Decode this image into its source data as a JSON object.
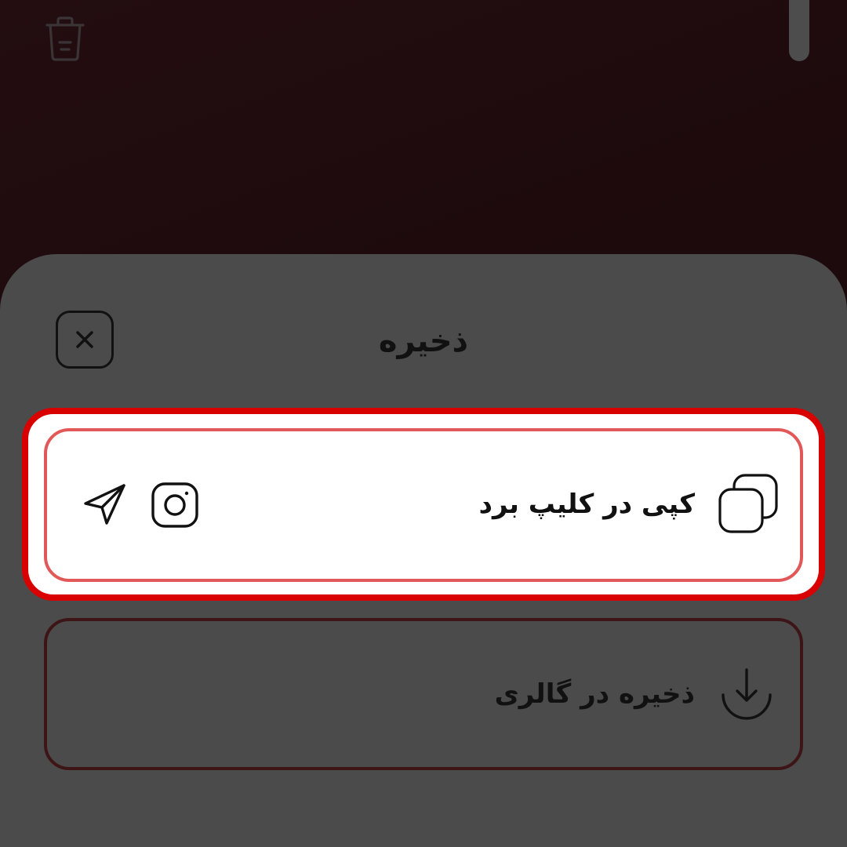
{
  "sheet": {
    "title": "ذخیره",
    "rows": [
      {
        "label": "کپی در کلیپ برد",
        "icon": "copy-icon",
        "share_icons": [
          "instagram-icon",
          "send-icon"
        ]
      },
      {
        "label": "ذخیره در گالری",
        "icon": "download-icon"
      }
    ]
  },
  "colors": {
    "sheet_bg": "#4b4b4b",
    "backdrop": "#1d0a0d",
    "highlight_border": "#d90000"
  }
}
